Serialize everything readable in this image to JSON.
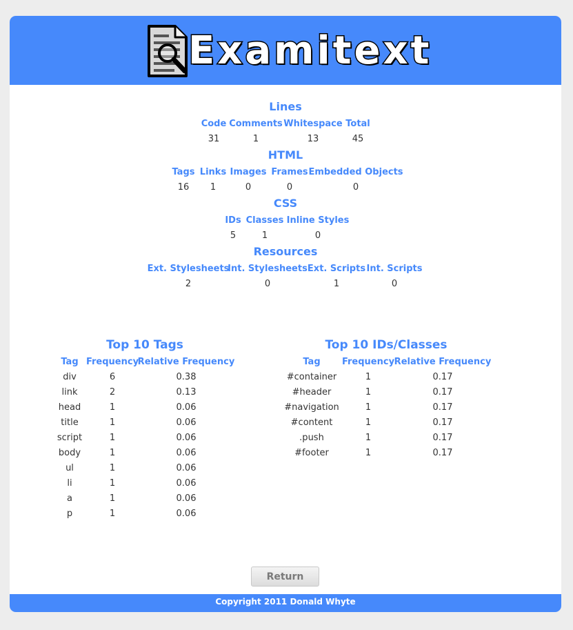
{
  "header": {
    "site_title": "Examitext"
  },
  "sections": {
    "lines": {
      "title": "Lines",
      "headers": [
        "Code",
        "Comments",
        "Whitespace",
        "Total"
      ],
      "values": [
        "31",
        "1",
        "13",
        "45"
      ]
    },
    "html": {
      "title": "HTML",
      "headers": [
        "Tags",
        "Links",
        "Images",
        "Frames",
        "Embedded Objects"
      ],
      "values": [
        "16",
        "1",
        "0",
        "0",
        "0"
      ]
    },
    "css": {
      "title": "CSS",
      "headers": [
        "IDs",
        "Classes",
        "Inline Styles"
      ],
      "values": [
        "5",
        "1",
        "0"
      ]
    },
    "resources": {
      "title": "Resources",
      "headers": [
        "Ext. Stylesheets",
        "Int. Stylesheets",
        "Ext. Scripts",
        "Int. Scripts"
      ],
      "values": [
        "2",
        "0",
        "1",
        "0"
      ]
    }
  },
  "top_tags": {
    "title": "Top 10 Tags",
    "headers": [
      "Tag",
      "Frequency",
      "Relative Frequency"
    ],
    "rows": [
      [
        "div",
        "6",
        "0.38"
      ],
      [
        "link",
        "2",
        "0.13"
      ],
      [
        "head",
        "1",
        "0.06"
      ],
      [
        "title",
        "1",
        "0.06"
      ],
      [
        "script",
        "1",
        "0.06"
      ],
      [
        "body",
        "1",
        "0.06"
      ],
      [
        "ul",
        "1",
        "0.06"
      ],
      [
        "li",
        "1",
        "0.06"
      ],
      [
        "a",
        "1",
        "0.06"
      ],
      [
        "p",
        "1",
        "0.06"
      ]
    ]
  },
  "top_ids": {
    "title": "Top 10 IDs/Classes",
    "headers": [
      "Tag",
      "Frequency",
      "Relative Frequency"
    ],
    "rows": [
      [
        "#container",
        "1",
        "0.17"
      ],
      [
        "#header",
        "1",
        "0.17"
      ],
      [
        "#navigation",
        "1",
        "0.17"
      ],
      [
        "#content",
        "1",
        "0.17"
      ],
      [
        ".push",
        "1",
        "0.17"
      ],
      [
        "#footer",
        "1",
        "0.17"
      ]
    ]
  },
  "actions": {
    "return_label": "Return"
  },
  "footer": {
    "copyright": "Copyright 2011 Donald Whyte"
  },
  "colors": {
    "accent": "#4689fb",
    "background": "#ededed"
  },
  "icons": {
    "logo": "document-magnifier-icon"
  }
}
